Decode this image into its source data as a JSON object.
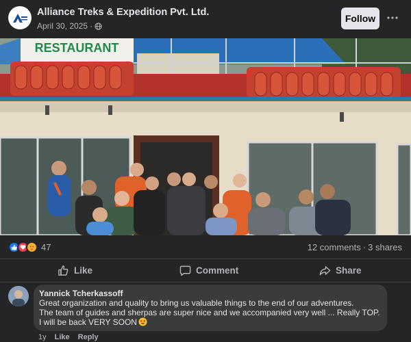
{
  "post": {
    "page_name": "Alliance Treks & Expedition Pvt. Ltd.",
    "date": "April 30, 2025",
    "separator": "·",
    "audience_icon": "globe-icon",
    "follow_label": "Follow",
    "more_icon": "more-dots-icon"
  },
  "photo": {
    "sign_text": "RESTAURANT",
    "colors": {
      "sign_green": "#1f8a4c",
      "roof_blue": "#2a6fb8",
      "railing_red": "#c0392b"
    }
  },
  "stats": {
    "reaction_icons": [
      "like-icon",
      "love-icon",
      "care-icon"
    ],
    "reaction_count": "47",
    "comments": "12 comments",
    "dot": "·",
    "shares": "3 shares"
  },
  "actions": {
    "like": "Like",
    "comment": "Comment",
    "share": "Share"
  },
  "comment": {
    "author": "Yannick Tcherkassoff",
    "lines": [
      "Great organization and quality to bring us valuable things to the end of our adventures.",
      "The team of guides and sherpas are super nice and we accompanied very well ... Really TOP.",
      "I will be back VERY SOON"
    ],
    "emoji": "star-struck-emoji",
    "time": "1y",
    "like": "Like",
    "reply": "Reply"
  },
  "colors": {
    "background": "#18191a",
    "card": "#242526",
    "bubble": "#3a3b3c",
    "text_primary": "#e4e6eb",
    "text_secondary": "#b0b3b8",
    "like_blue": "#1877f2",
    "love_red": "#f33e58"
  }
}
